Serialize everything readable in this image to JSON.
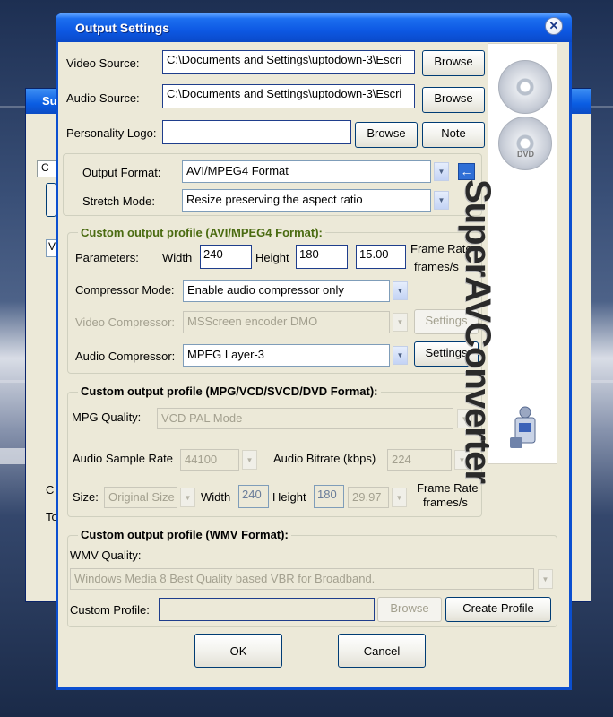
{
  "background_window": {
    "title": "Su",
    "tab_label": "C",
    "row_labels": [
      "C",
      "To"
    ]
  },
  "dialog": {
    "title": "Output Settings",
    "close_glyph": "✕",
    "video_source": {
      "label": "Video Source:",
      "value": "C:\\Documents and Settings\\uptodown-3\\Escri",
      "button": "Browse"
    },
    "audio_source": {
      "label": "Audio Source:",
      "value": "C:\\Documents and Settings\\uptodown-3\\Escri",
      "button": "Browse"
    },
    "personality_logo": {
      "label": "Personality Logo:",
      "value": "",
      "browse_button": "Browse",
      "note_button": "Note"
    },
    "output_format": {
      "label": "Output Format:",
      "value": "AVI/MPEG4 Format",
      "back_icon": "←"
    },
    "stretch_mode": {
      "label": "Stretch Mode:",
      "value": "Resize preserving the aspect ratio"
    },
    "avi_profile": {
      "title": "Custom output profile (AVI/MPEG4 Format):",
      "parameters_label": "Parameters:",
      "width_label": "Width",
      "width": "240",
      "height_label": "Height",
      "height": "180",
      "frame_rate": "15.00",
      "frame_rate_label_1": "Frame Rate",
      "frame_rate_label_2": "frames/s",
      "compressor_mode": {
        "label": "Compressor Mode:",
        "value": "Enable audio compressor only"
      },
      "video_compressor": {
        "label": "Video Compressor:",
        "value": "MSScreen encoder DMO",
        "button": "Settings"
      },
      "audio_compressor": {
        "label": "Audio Compressor:",
        "value": "MPEG Layer-3",
        "button": "Settings"
      }
    },
    "mpg_profile": {
      "title": "Custom output profile (MPG/VCD/SVCD/DVD Format):",
      "quality_label": "MPG Quality:",
      "quality_value": "VCD PAL Mode",
      "sample_rate_label": "Audio Sample Rate",
      "sample_rate_value": "44100",
      "bitrate_label": "Audio Bitrate (kbps)",
      "bitrate_value": "224",
      "size_label": "Size:",
      "size_value": "Original Size",
      "width_label": "Width",
      "width": "240",
      "height_label": "Height",
      "height": "180",
      "frame_rate": "29.97",
      "frame_rate_label_1": "Frame Rate",
      "frame_rate_label_2": "frames/s"
    },
    "wmv_profile": {
      "title": "Custom output profile (WMV Format):",
      "quality_label": "WMV Quality:",
      "quality_value": "Windows Media 8 Best Quality based VBR for Broadband.",
      "custom_profile_label": "Custom Profile:",
      "custom_profile_value": "",
      "browse_button": "Browse",
      "create_button": "Create Profile"
    },
    "ok_button": "OK",
    "cancel_button": "Cancel"
  },
  "banner": {
    "brand_main": "SuperAVConverter",
    "cd_label": "DVD"
  },
  "colors": {
    "titlebar": "#0d58e3",
    "dialog_bg": "#ece9d8",
    "group_title_green": "#4a6b11",
    "field_border": "#1f3e8c"
  }
}
